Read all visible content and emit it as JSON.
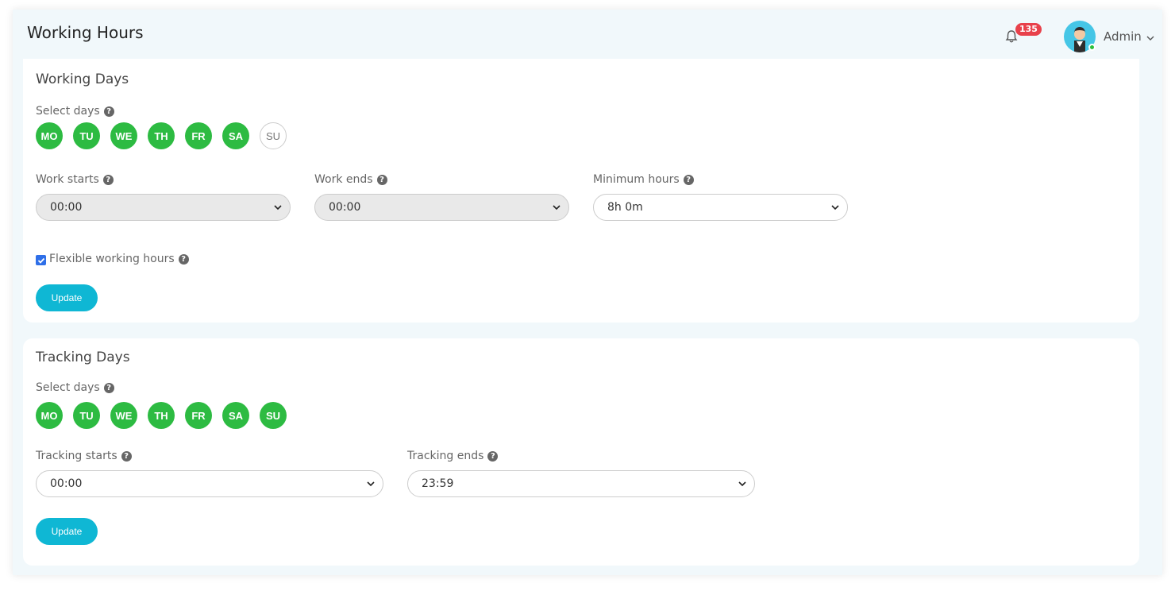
{
  "header": {
    "title": "Working Hours",
    "notifications_count": "135",
    "user_name": "Admin"
  },
  "working_days": {
    "title": "Working Days",
    "select_days_label": "Select days",
    "days": [
      {
        "label": "MO",
        "selected": true
      },
      {
        "label": "TU",
        "selected": true
      },
      {
        "label": "WE",
        "selected": true
      },
      {
        "label": "TH",
        "selected": true
      },
      {
        "label": "FR",
        "selected": true
      },
      {
        "label": "SA",
        "selected": true
      },
      {
        "label": "SU",
        "selected": false
      }
    ],
    "work_starts": {
      "label": "Work starts",
      "value": "00:00",
      "disabled": true
    },
    "work_ends": {
      "label": "Work ends",
      "value": "00:00",
      "disabled": true
    },
    "minimum_hours": {
      "label": "Minimum hours",
      "value": "8h 0m"
    },
    "flexible": {
      "label": "Flexible working hours",
      "checked": true
    },
    "update_label": "Update"
  },
  "tracking_days": {
    "title": "Tracking Days",
    "select_days_label": "Select days",
    "days": [
      {
        "label": "MO",
        "selected": true
      },
      {
        "label": "TU",
        "selected": true
      },
      {
        "label": "WE",
        "selected": true
      },
      {
        "label": "TH",
        "selected": true
      },
      {
        "label": "FR",
        "selected": true
      },
      {
        "label": "SA",
        "selected": true
      },
      {
        "label": "SU",
        "selected": true
      }
    ],
    "tracking_starts": {
      "label": "Tracking starts",
      "value": "00:00"
    },
    "tracking_ends": {
      "label": "Tracking ends",
      "value": "23:59"
    },
    "update_label": "Update"
  },
  "colors": {
    "accent": "#0fb7d4",
    "day_selected": "#2dbb42",
    "badge": "#e8414b",
    "background": "#f1f8fb"
  },
  "icons": [
    "bell-icon",
    "chevron-down-icon",
    "question-circle-icon",
    "avatar-icon"
  ]
}
